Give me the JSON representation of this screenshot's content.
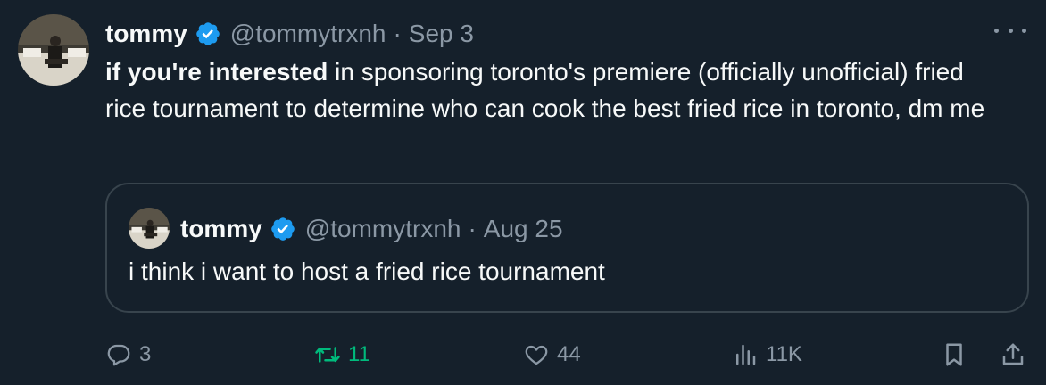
{
  "tweet": {
    "name": "tommy",
    "handle": "@tommytrxnh",
    "separator": "·",
    "date": "Sep 3",
    "text_bold": "if you're interested",
    "text_rest": " in sponsoring toronto's premiere (officially unofficial) fried rice tournament to determine who can cook the best fried rice in toronto, dm me"
  },
  "quoted": {
    "name": "tommy",
    "handle": "@tommytrxnh",
    "separator": "·",
    "date": "Aug 25",
    "text": "i think i want to host a fried rice tournament"
  },
  "actions": {
    "replies": "3",
    "retweets": "11",
    "likes": "44",
    "views": "11K"
  },
  "colors": {
    "background": "#15202b",
    "text_primary": "#f7f9f9",
    "text_secondary": "#8b98a5",
    "verified_blue": "#1d9bf0",
    "retweet_green": "#00ba7c",
    "border": "#38444d"
  },
  "icons": {
    "verified": "verified-badge-icon",
    "more": "more-horizontal-icon",
    "reply": "reply-icon",
    "retweet": "retweet-icon",
    "like": "heart-icon",
    "views": "views-chart-icon",
    "bookmark": "bookmark-icon",
    "share": "share-icon"
  }
}
